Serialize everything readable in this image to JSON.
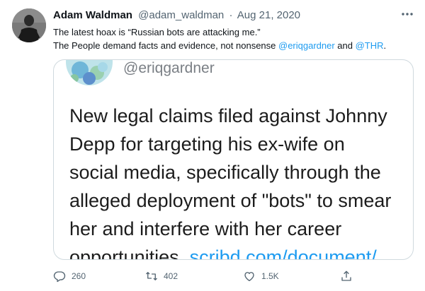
{
  "tweet": {
    "author_name": "Adam Waldman",
    "author_handle": "@adam_waldman",
    "separator": "·",
    "date": "Aug 21, 2020",
    "text_line1": "The latest hoax is “Russian bots are attacking me.”",
    "text_line2_prefix": "The People demand facts and evidence, not nonsense ",
    "mention1": "@eriqgardner",
    "text_and": " and ",
    "mention2": "@THR",
    "text_end": "."
  },
  "media": {
    "handle": "@eriqgardner",
    "lines": [
      "New legal claims filed against Johnny",
      "Depp for targeting his ex-wife on",
      "social media, specifically through the",
      "alleged deployment of \"bots\" to smear",
      "her and interfere with her career"
    ],
    "last_line_prefix": "opportunities. ",
    "link": "scribd.com/document/"
  },
  "actions": {
    "reply_count": "260",
    "retweet_count": "402",
    "like_count": "1.5K"
  },
  "icons": {
    "more": "more-options-icon",
    "reply": "reply-icon",
    "retweet": "retweet-icon",
    "like": "heart-icon",
    "share": "share-icon"
  },
  "colors": {
    "accent": "#1d9bf0",
    "secondary_text": "#536471"
  }
}
